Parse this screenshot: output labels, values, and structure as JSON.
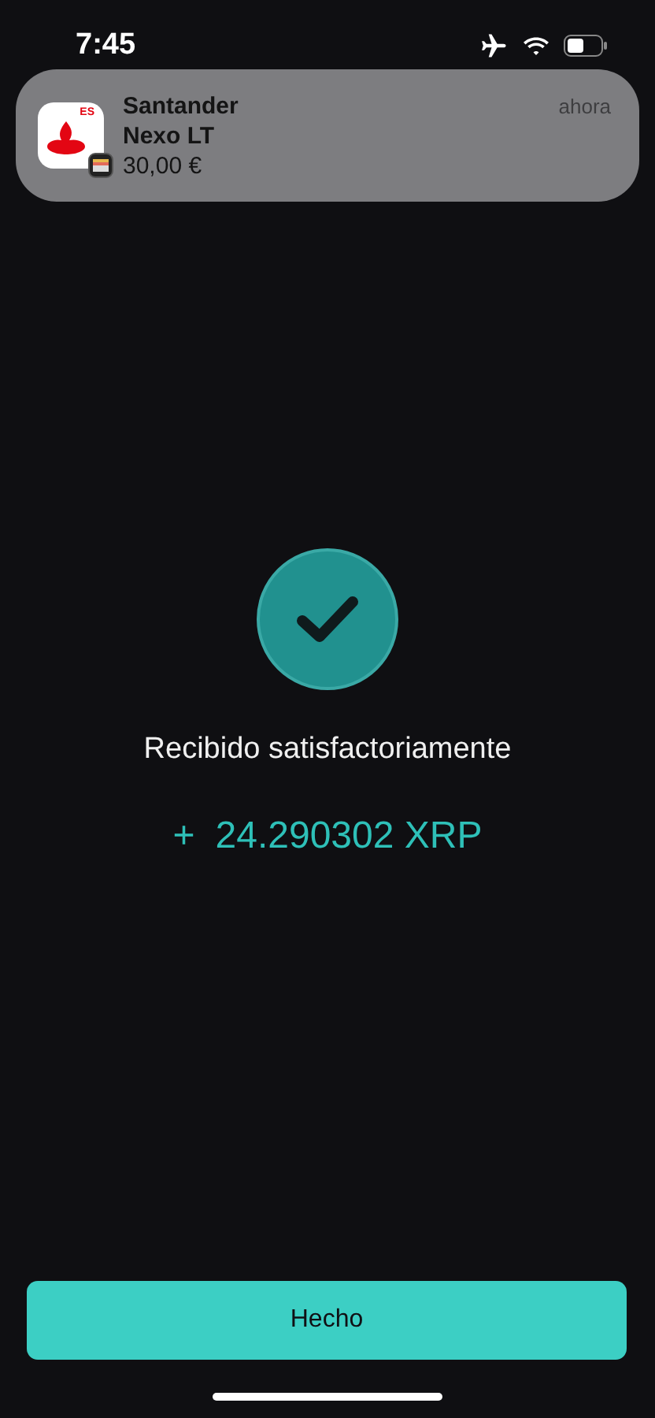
{
  "status_bar": {
    "time": "7:45"
  },
  "notification": {
    "app_badge": "ES",
    "title": "Santander",
    "subtitle": "Nexo LT",
    "body": "30,00 €",
    "time": "ahora"
  },
  "result": {
    "message": "Recibido satisfactoriamente",
    "sign": "+",
    "amount": "24.290302 XRP"
  },
  "button": {
    "label": "Hecho"
  }
}
